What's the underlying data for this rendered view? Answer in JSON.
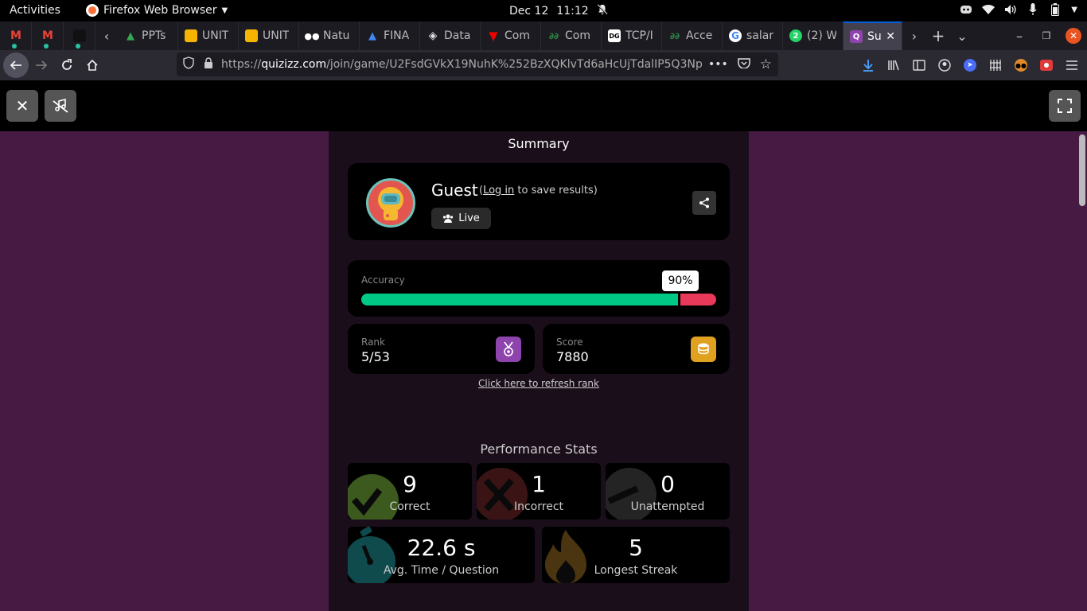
{
  "system": {
    "activities": "Activities",
    "app_name": "Firefox Web Browser",
    "date": "Dec 12",
    "time": "11:12"
  },
  "tabs": [
    {
      "label": "",
      "favicon": "gmail-icon",
      "color": "#ea4335",
      "letter": "M"
    },
    {
      "label": "",
      "favicon": "gmail-icon",
      "color": "#ea4335",
      "letter": "M"
    },
    {
      "label": "",
      "favicon": "dark-site-icon",
      "color": "#222222",
      "letter": ""
    },
    {
      "label": "PPTs",
      "favicon": "google-drive-icon",
      "color": "#1a73e8",
      "letter": "▲"
    },
    {
      "label": "UNIT",
      "favicon": "google-slides-icon",
      "color": "#f4b400",
      "letter": ""
    },
    {
      "label": "UNIT",
      "favicon": "google-slides-icon",
      "color": "#f4b400",
      "letter": ""
    },
    {
      "label": "Natu",
      "favicon": "medium-icon",
      "color": "#000000",
      "letter": "●●"
    },
    {
      "label": "FINA",
      "favicon": "google-drive-icon",
      "color": "#1a73e8",
      "letter": "▲"
    },
    {
      "label": "Data",
      "favicon": "diamond-icon",
      "color": "#555555",
      "letter": "◈"
    },
    {
      "label": "Com",
      "favicon": "v-logo-icon",
      "color": "#cc0000",
      "letter": "V"
    },
    {
      "label": "Com",
      "favicon": "gfg-icon",
      "color": "#2f8d46",
      "letter": "Ꝩ"
    },
    {
      "label": "TCP/I",
      "favicon": "dg-icon",
      "color": "#333333",
      "letter": "DG"
    },
    {
      "label": "Acce",
      "favicon": "gfg-icon",
      "color": "#2f8d46",
      "letter": "Ꝩ"
    },
    {
      "label": "salar",
      "favicon": "google-icon",
      "color": "#ffffff",
      "letter": "G"
    },
    {
      "label": "(2) W",
      "favicon": "whatsapp-icon",
      "color": "#25d366",
      "letter": "2"
    },
    {
      "label": "Su",
      "favicon": "quizizz-icon",
      "color": "#8e44ad",
      "letter": "Q"
    }
  ],
  "url": {
    "prefix": "https://",
    "host": "quizizz.com",
    "path": "/join/game/U2FsdGVkX19NuhK%252BzXQKlvTd6aHcUjTdalIP5Q3Np"
  },
  "summary": {
    "title": "Summary",
    "player": {
      "name": "Guest",
      "login_link": "Log in",
      "login_suffix": "to save results)",
      "login_prefix": "(",
      "mode": "Live"
    },
    "accuracy": {
      "label": "Accuracy",
      "value_text": "90%",
      "value": 0.9
    },
    "rank": {
      "label": "Rank",
      "value": "5/53"
    },
    "score": {
      "label": "Score",
      "value": "7880"
    },
    "refresh_link": "Click here to refresh rank"
  },
  "performance": {
    "title": "Performance Stats",
    "correct": {
      "value": "9",
      "label": "Correct"
    },
    "incorrect": {
      "value": "1",
      "label": "Incorrect"
    },
    "unattempted": {
      "value": "0",
      "label": "Unattempted"
    },
    "avg_time": {
      "value": "22.6 s",
      "label": "Avg. Time / Question"
    },
    "streak": {
      "value": "5",
      "label": "Longest Streak"
    }
  },
  "colors": {
    "page_bg": "#461a42",
    "panel_bg": "#1b0e1b",
    "accuracy_correct": "#00c985",
    "accuracy_wrong": "#e8395a",
    "rank_badge": "#8e44ad",
    "score_badge": "#e0a020"
  }
}
